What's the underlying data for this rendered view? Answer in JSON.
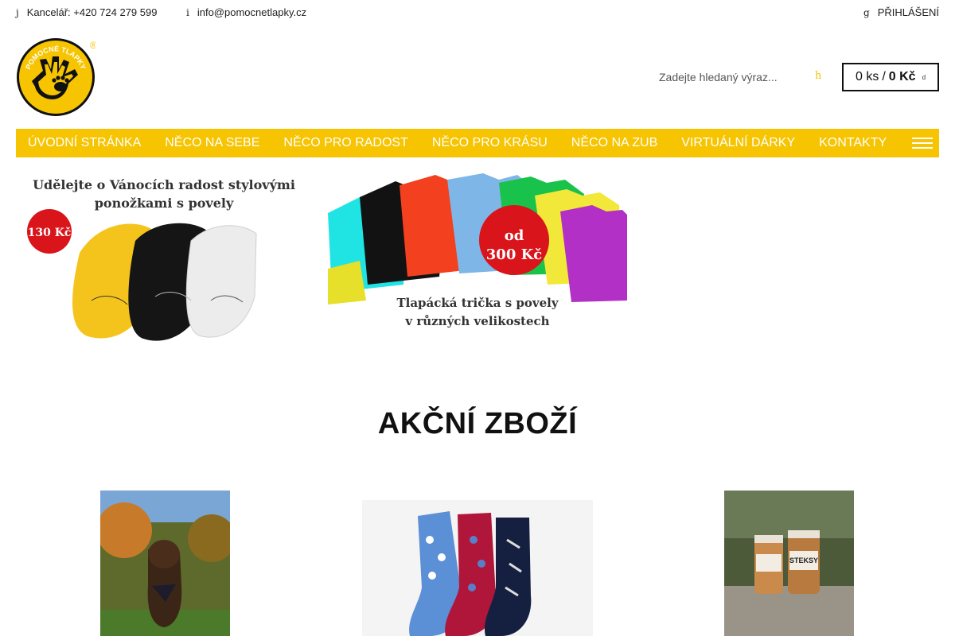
{
  "topbar": {
    "phone_icon": "j",
    "phone": "Kancelář: +420 724 279 599",
    "mail_icon": "i",
    "email": "info@pomocnetlapky.cz",
    "login_icon": "g",
    "login": "PŘIHLÁŠENÍ"
  },
  "logo": {
    "top_text": "POMOCNÉ TLAPKY",
    "mark": "®"
  },
  "search": {
    "placeholder": "Zadejte hledaný výraz...",
    "button_icon": "h"
  },
  "cart": {
    "count": "0 ks",
    "separator": "/",
    "total": "0 Kč",
    "icon": "d"
  },
  "nav": {
    "items": [
      "ÚVODNÍ STRÁNKA",
      "NĚCO NA SEBE",
      "NĚCO PRO RADOST",
      "NĚCO PRO KRÁSU",
      "NĚCO NA ZUB",
      "VIRTUÁLNÍ DÁRKY",
      "KONTAKTY"
    ]
  },
  "banners": {
    "socks": {
      "headline_1": "Udělejte o Vánocích radost stylovými",
      "headline_2": "ponožkami s povely",
      "price": "130 Kč"
    },
    "tshirts": {
      "price_1": "od",
      "price_2": "300 Kč",
      "caption_1": "Tlapácká trička s povely",
      "caption_2": "v různých velikostech"
    }
  },
  "section": {
    "title": "AKČNÍ ZBOŽÍ"
  },
  "products": {
    "p3_label": "STEKSY"
  },
  "colors": {
    "accent": "#f6c400",
    "price_badge": "#d9141b"
  }
}
